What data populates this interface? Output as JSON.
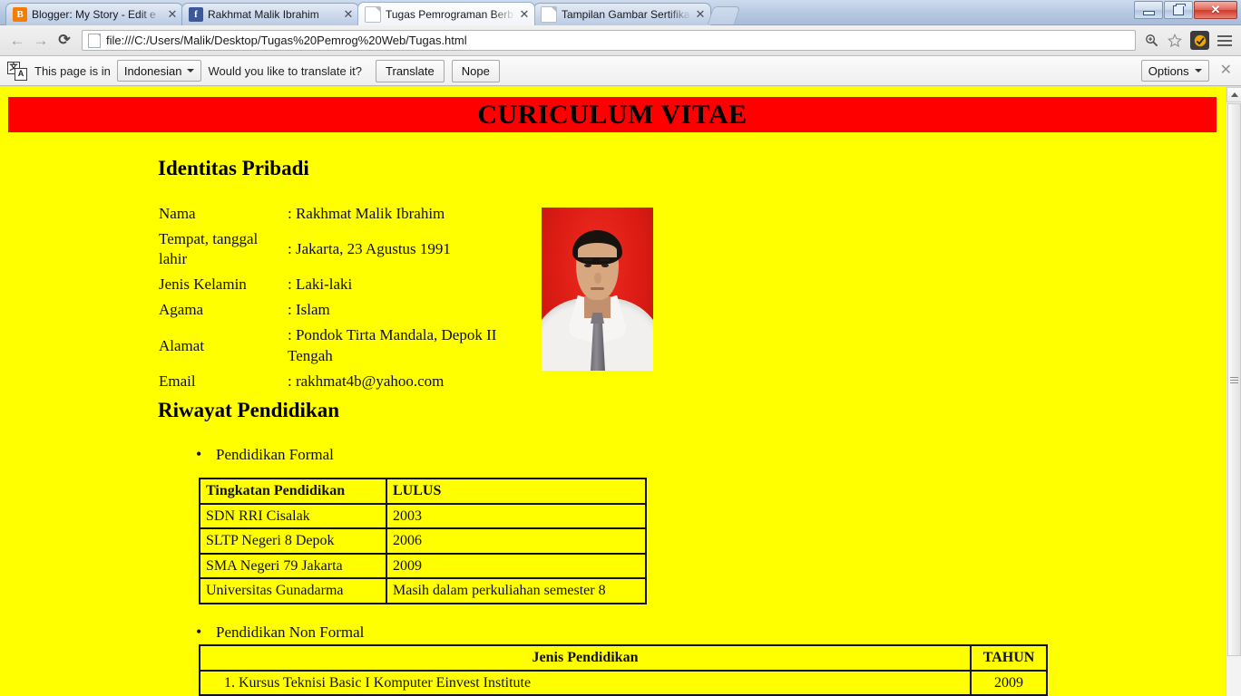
{
  "window": {
    "minimize_label": "Minimize",
    "restore_label": "Restore",
    "close_label": "✕"
  },
  "tabs": [
    {
      "title": "Blogger: My Story - Edit e",
      "favicon": "blogger-icon",
      "favicon_glyph": "B",
      "active": false,
      "close_label": "✕"
    },
    {
      "title": "Rakhmat Malik Ibrahim",
      "favicon": "facebook-icon",
      "favicon_glyph": "f",
      "active": false,
      "close_label": "✕"
    },
    {
      "title": "Tugas Pemrograman Berb",
      "favicon": "document-icon",
      "favicon_glyph": "",
      "active": true,
      "close_label": "✕"
    },
    {
      "title": "Tampilan Gambar Sertifika",
      "favicon": "document-icon",
      "favicon_glyph": "",
      "active": false,
      "close_label": "✕"
    }
  ],
  "toolbar": {
    "back_label": "←",
    "forward_label": "→",
    "reload_label": "⟳",
    "url": "file:///C:/Users/Malik/Desktop/Tugas%20Pemrog%20Web/Tugas.html",
    "zoom_label": "⊕",
    "bookmark_label": "☆",
    "extension_label": "◉",
    "menu_label": "≡"
  },
  "infobar": {
    "prefix_text": "This page is in",
    "language": "Indonesian",
    "question_text": "Would you like to translate it?",
    "translate_button": "Translate",
    "nope_button": "Nope",
    "options_button": "Options",
    "close_label": "✕"
  },
  "page": {
    "banner_title": "CURICULUM VITAE",
    "banner_color": "#ff0000",
    "background_color": "#ffff00",
    "section_identitas": "Identitas Pribadi",
    "identity_rows": [
      {
        "label": "Nama",
        "value": ": Rakhmat Malik Ibrahim"
      },
      {
        "label": "Tempat, tanggal lahir",
        "value": ": Jakarta, 23 Agustus 1991"
      },
      {
        "label": "Jenis Kelamin",
        "value": ": Laki-laki"
      },
      {
        "label": "Agama",
        "value": ": Islam"
      },
      {
        "label": "Alamat",
        "value": ": Pondok Tirta Mandala, Depok II Tengah"
      },
      {
        "label": "Email",
        "value": ": rakhmat4b@yahoo.com"
      }
    ],
    "photo_alt": "portrait-photo",
    "section_riwayat": "Riwayat Pendidikan",
    "bullet_formal": "Pendidikan Formal",
    "formal_table": {
      "headers": [
        "Tingkatan Pendidikan",
        "LULUS"
      ],
      "rows": [
        [
          "SDN RRI Cisalak",
          "2003"
        ],
        [
          "SLTP Negeri 8 Depok",
          "2006"
        ],
        [
          "SMA Negeri 79 Jakarta",
          "2009"
        ],
        [
          "Universitas Gunadarma",
          "Masih dalam perkuliahan semester 8"
        ]
      ]
    },
    "bullet_nonformal": "Pendidikan Non Formal",
    "nonformal_table": {
      "headers": [
        "Jenis Pendidikan",
        "TAHUN"
      ],
      "rows": [
        [
          "1.  Kursus Teknisi Basic I Komputer Einvest Institute",
          "2009"
        ]
      ]
    }
  }
}
